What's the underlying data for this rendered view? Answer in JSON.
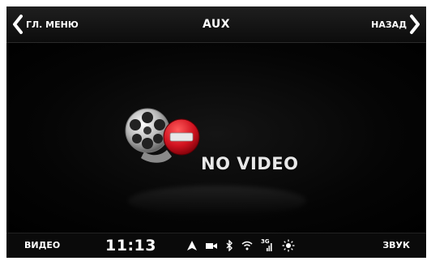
{
  "header": {
    "main_menu_label": "ГЛ. МЕНЮ",
    "title": "AUX",
    "back_label": "НАЗАД"
  },
  "main": {
    "status_message": "NO VIDEO"
  },
  "footer": {
    "video_label": "ВИДЕО",
    "time": "11:13",
    "network_type": "3G",
    "sound_label": "ЗВУК"
  },
  "icons": [
    "chevron-left-icon",
    "chevron-right-icon",
    "film-reel-icon",
    "no-entry-icon",
    "navigation-arrow-icon",
    "camera-icon",
    "bluetooth-icon",
    "wifi-icon",
    "signal-icon",
    "brightness-icon"
  ],
  "colors": {
    "background": "#000000",
    "text": "#ffffff",
    "no_entry_red": "#c8102e"
  }
}
